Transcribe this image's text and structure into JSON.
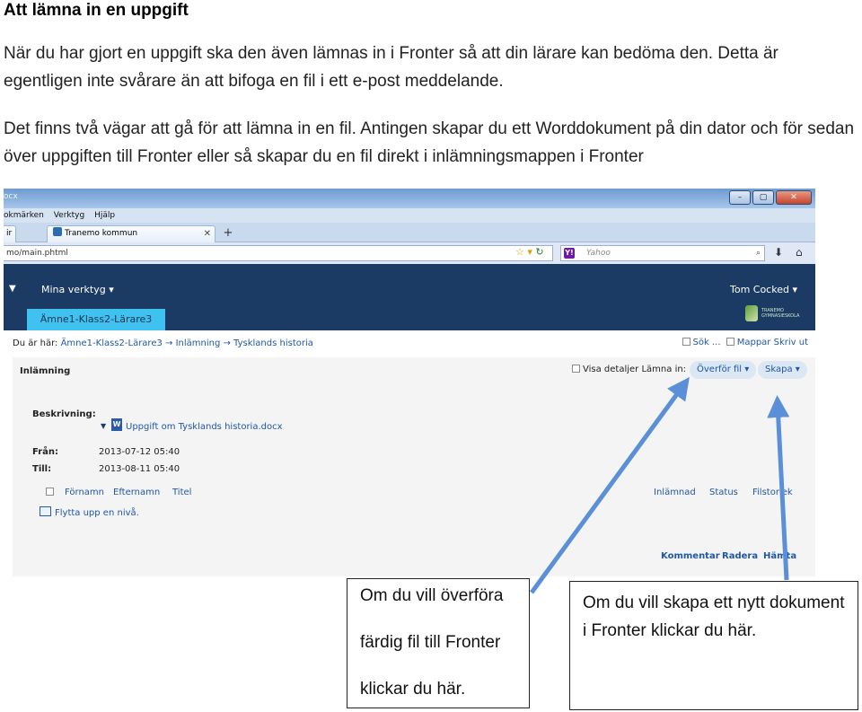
{
  "doc": {
    "title": "Att lämna in en uppgift",
    "paragraph1": "När du har gjort en uppgift ska den även lämnas in i Fronter så att din lärare kan bedöma den. Detta är egentligen inte svårare än att bifoga en fil i ett e-post meddelande.",
    "paragraph2": "Det finns två vägar att gå för att lämna in en fil. Antingen skapar du ett Worddokument på din dator och för sedan över uppgiften till Fronter eller så skapar du en fil direkt i inlämningsmappen i Fronter"
  },
  "browser": {
    "titlebar_text": "ocx",
    "menu": [
      "okmärken",
      "Verktyg",
      "Hjälp"
    ],
    "tab_partial": "ir",
    "tab_title": "Tranemo kommun",
    "tab_new": "+",
    "url": "mo/main.phtml",
    "search_placeholder": "Yahoo",
    "search_engine_glyph": "Y!",
    "window_buttons": [
      "–",
      "▢",
      "✕"
    ]
  },
  "app": {
    "menu_label": "Mina verktyg",
    "user_name": "Tom Cocked",
    "class_tab": "Ämne1-Klass2-Lärare3",
    "logo_text": "TRANEMO GYMNASIESKOLA",
    "breadcrumb": {
      "lead": "Du är här:",
      "path": "Ämne1-Klass2-Lärare3 → Inlämning → Tysklands historia"
    },
    "tools": {
      "search": "Sök ...",
      "folders": "Mappar",
      "print": "Skriv ut"
    }
  },
  "panel": {
    "title": "Inlämning",
    "show_details": "Visa detaljer",
    "submit_in": "Lämna in:",
    "transfer_button": "Överför fil",
    "create_button": "Skapa",
    "description_label": "Beskrivning:",
    "file_name": "Uppgift om Tysklands historia.docx",
    "from_label": "Från:",
    "from_value": "2013-07-12 05:40",
    "to_label": "Till:",
    "to_value": "2013-08-11 05:40",
    "columns": [
      "Förnamn",
      "Efternamn",
      "Titel",
      "Inlämnad",
      "Status",
      "Filstorlek"
    ],
    "move_up": "Flytta upp en nivå.",
    "actions": [
      "Kommentar",
      "Radera",
      "Hämta"
    ]
  },
  "callouts": {
    "transfer": {
      "line1": "Om du vill överföra",
      "line2": "färdig fil till Fronter",
      "line3": "klickar du här."
    },
    "create": "Om du vill skapa ett nytt dokument i Fronter klickar du här."
  },
  "colors": {
    "header_bg": "#1b3a64",
    "class_tab_bg": "#3fc2ef",
    "link": "#1f57a8",
    "arrow": "#5b8fd8"
  }
}
